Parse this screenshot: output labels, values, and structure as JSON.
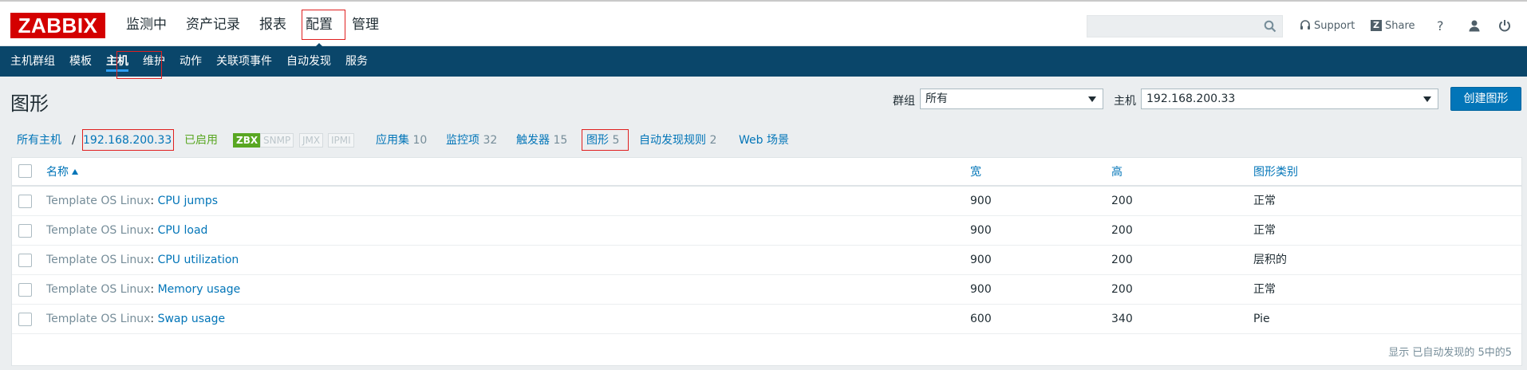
{
  "header": {
    "logo": "ZABBIX",
    "menu": [
      "监测中",
      "资产记录",
      "报表",
      "配置",
      "管理"
    ],
    "active_menu": "配置",
    "search_placeholder": "",
    "support_label": "Support",
    "share_label": "Share",
    "help_label": "?",
    "share_badge": "Z"
  },
  "submenu": {
    "items": [
      "主机群组",
      "模板",
      "主机",
      "维护",
      "动作",
      "关联项事件",
      "自动发现",
      "服务"
    ],
    "active": "主机"
  },
  "page": {
    "title": "图形",
    "group_label": "群组",
    "group_value": "所有",
    "host_label": "主机",
    "host_value": "192.168.200.33",
    "create_button": "创建图形"
  },
  "hostnav": {
    "all_hosts": "所有主机",
    "separator": "/",
    "host": "192.168.200.33",
    "status": "已启用",
    "badges": [
      "ZBX",
      "SNMP",
      "JMX",
      "IPMI"
    ],
    "links": [
      {
        "label": "应用集",
        "count": "10"
      },
      {
        "label": "监控项",
        "count": "32"
      },
      {
        "label": "触发器",
        "count": "15"
      },
      {
        "label": "图形",
        "count": "5"
      },
      {
        "label": "自动发现规则",
        "count": "2"
      },
      {
        "label": "Web 场景",
        "count": ""
      }
    ]
  },
  "table": {
    "columns": [
      "名称",
      "宽",
      "高",
      "图形类别"
    ],
    "rows": [
      {
        "template": "Template OS Linux",
        "sep": ": ",
        "name": "CPU jumps",
        "width": "900",
        "height": "200",
        "type": "正常"
      },
      {
        "template": "Template OS Linux",
        "sep": ": ",
        "name": "CPU load",
        "width": "900",
        "height": "200",
        "type": "正常"
      },
      {
        "template": "Template OS Linux",
        "sep": ": ",
        "name": "CPU utilization",
        "width": "900",
        "height": "200",
        "type": "层积的"
      },
      {
        "template": "Template OS Linux",
        "sep": ": ",
        "name": "Memory usage",
        "width": "900",
        "height": "200",
        "type": "正常"
      },
      {
        "template": "Template OS Linux",
        "sep": ": ",
        "name": "Swap usage",
        "width": "600",
        "height": "340",
        "type": "Pie"
      }
    ],
    "footer": "显示 已自动发现的 5中的5"
  },
  "colors": {
    "brand": "#d40000",
    "nav": "#0a466a",
    "link": "#0275b8",
    "enabled": "#59a722"
  }
}
